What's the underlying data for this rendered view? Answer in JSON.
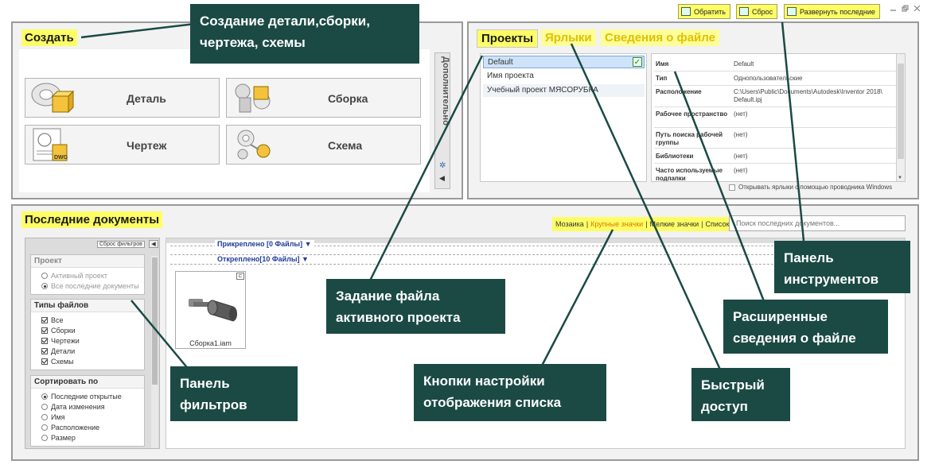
{
  "toolbar": {
    "reset_label": "Обратить",
    "sbros_label": "Сброс",
    "expand_label": "Развернуть последние"
  },
  "create": {
    "title": "Создать",
    "buttons": [
      {
        "label": "Деталь"
      },
      {
        "label": "Сборка"
      },
      {
        "label": "Чертеж"
      },
      {
        "label": "Схема"
      }
    ],
    "side_tab": "Дополнительно",
    "dwg_badge": "DWG"
  },
  "projects": {
    "tabs": [
      "Проекты",
      "Ярлыки",
      "Сведения о файле"
    ],
    "list": [
      {
        "name": "Default",
        "checked": true
      },
      {
        "name": "Имя проекта",
        "checked": false
      },
      {
        "name": "Учебный проект МЯСОРУБКА",
        "checked": false
      }
    ],
    "details": [
      {
        "key": "Имя",
        "value": "Default"
      },
      {
        "key": "Тип",
        "value": "Однопользовательские"
      },
      {
        "key": "Расположение",
        "value": "C:\\Users\\Public\\Documents\\Autodesk\\Inventor 2018\\ Default.ipj"
      },
      {
        "key": "Рабочее пространство",
        "value": "(нет)"
      },
      {
        "key": "Путь поиска рабочей группы",
        "value": "(нет)"
      },
      {
        "key": "Библиотеки",
        "value": "(нет)"
      },
      {
        "key": "Часто используемые подпапки",
        "value": "(нет)"
      }
    ],
    "open_shortcuts_label": "Открывать ярлыки с помощью проводника Windows"
  },
  "recent": {
    "title": "Последние документы",
    "view_modes": {
      "mosaic": "Мозаика",
      "large": "Крупные значки",
      "small": "Мелкие значки",
      "list": "Список",
      "separator": "|"
    },
    "search_placeholder": "Поиск последних документов...",
    "pinned": "Прикреплено [0 Файлы] ▼",
    "unpinned": "Откреплено[10 Файлы] ▼",
    "file_name": "Сборка1.iam",
    "filters": {
      "reset_label": "Сброс фильтров",
      "project": {
        "header": "Проект",
        "options": [
          {
            "label": "Активный проект",
            "on": false
          },
          {
            "label": "Все последние документы",
            "on": true
          }
        ]
      },
      "file_types": {
        "header": "Типы файлов",
        "options": [
          "Все",
          "Сборки",
          "Чертежи",
          "Детали",
          "Схемы"
        ]
      },
      "sort": {
        "header": "Сортировать по",
        "options": [
          {
            "label": "Последние открытые",
            "on": true
          },
          {
            "label": "Дата изменения",
            "on": false
          },
          {
            "label": "Имя",
            "on": false
          },
          {
            "label": "Расположение",
            "on": false
          },
          {
            "label": "Размер",
            "on": false
          }
        ]
      }
    }
  },
  "callouts": {
    "create": "Создание детали,сборки, чертежа, схемы",
    "toolbar": "Панель инструментов",
    "project_file": "Задание файла активного проекта",
    "extended": "Расширенные сведения о файле",
    "filters": "Панель фильтров",
    "display": "Кнопки настройки отображения списка",
    "quick": "Быстрый доступ"
  },
  "colors": {
    "highlight": "#fdfd66",
    "callout_bg": "#1b4a45",
    "callout_text": "#ffffff",
    "selection": "#cfe3f8"
  }
}
